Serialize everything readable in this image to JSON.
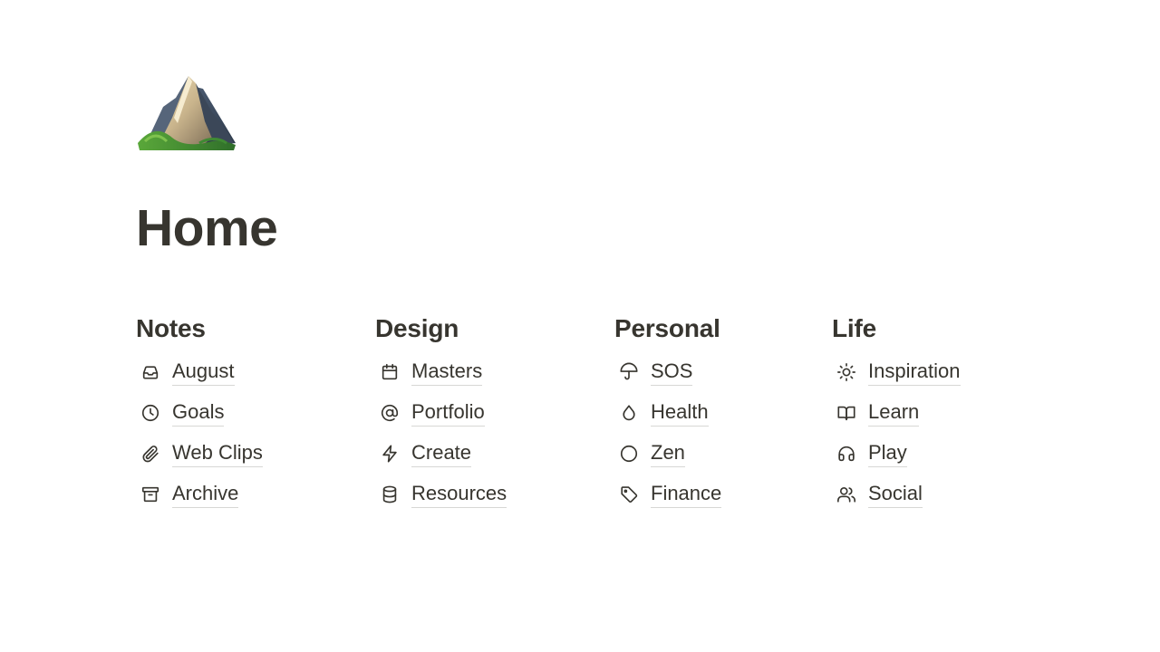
{
  "page": {
    "title": "Home",
    "icon": "mountain-emoji"
  },
  "columns": [
    {
      "heading": "Notes",
      "items": [
        {
          "label": "August",
          "icon": "inbox-icon"
        },
        {
          "label": "Goals",
          "icon": "clock-icon"
        },
        {
          "label": "Web Clips",
          "icon": "paperclip-icon"
        },
        {
          "label": "Archive",
          "icon": "archive-icon"
        }
      ]
    },
    {
      "heading": "Design",
      "items": [
        {
          "label": "Masters",
          "icon": "calendar-icon"
        },
        {
          "label": "Portfolio",
          "icon": "at-sign-icon"
        },
        {
          "label": "Create",
          "icon": "lightning-icon"
        },
        {
          "label": "Resources",
          "icon": "database-icon"
        }
      ]
    },
    {
      "heading": "Personal",
      "items": [
        {
          "label": "SOS",
          "icon": "umbrella-icon"
        },
        {
          "label": "Health",
          "icon": "droplet-icon"
        },
        {
          "label": "Zen",
          "icon": "circle-icon"
        },
        {
          "label": "Finance",
          "icon": "tag-icon"
        }
      ]
    },
    {
      "heading": "Life",
      "items": [
        {
          "label": "Inspiration",
          "icon": "sun-icon"
        },
        {
          "label": "Learn",
          "icon": "book-open-icon"
        },
        {
          "label": "Play",
          "icon": "headphones-icon"
        },
        {
          "label": "Social",
          "icon": "users-icon"
        }
      ]
    }
  ]
}
